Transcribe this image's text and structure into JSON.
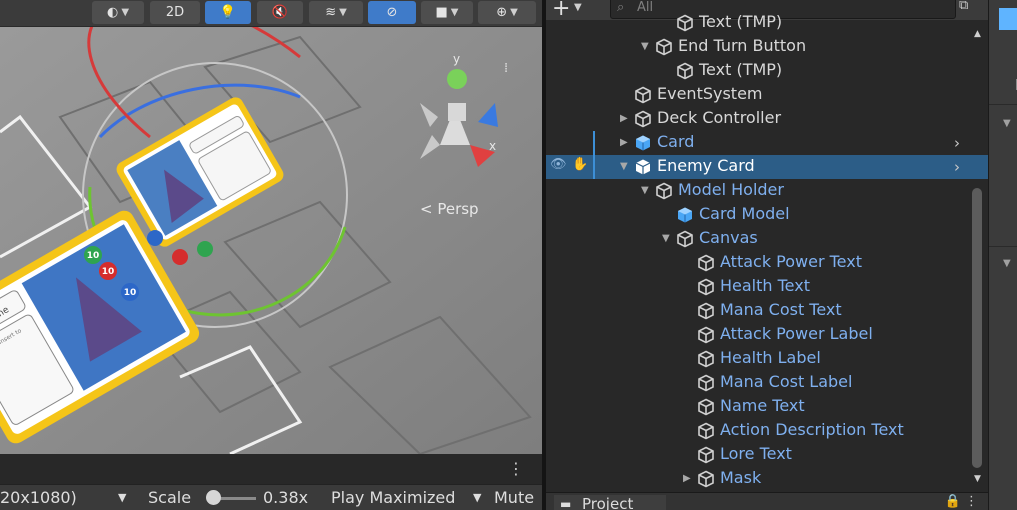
{
  "scene": {
    "toolbar": {
      "mode_2d": "2D",
      "icons": [
        "shading-mode-icon",
        "lighting-bulb-icon",
        "audio-mute-icon",
        "effects-icon",
        "visibility-icon",
        "camera-icon",
        "gizmo-icon"
      ]
    },
    "persp_label": "< Persp",
    "gizmo_axes": {
      "y": "y",
      "x": "x"
    }
  },
  "game": {
    "resolution": "20x1080)",
    "scale_label": "Scale",
    "scale_value": "0.38x",
    "scale_fraction": 0.1,
    "play_mode": "Play Maximized",
    "mute": "Mute"
  },
  "cards": {
    "main": {
      "name": "Card Name",
      "placeholder": "Place to Insert to",
      "lines": [
        "s",
        "ck"
      ]
    },
    "stat_badges": {
      "attack": "10",
      "health": "10",
      "mana": "10"
    }
  },
  "hierarchy": {
    "search_placeholder": "All",
    "items": [
      {
        "label": "Text (TMP)",
        "depth": 2,
        "arrow": "",
        "kind": "gameobject"
      },
      {
        "label": "End Turn Button",
        "depth": 1,
        "arrow": "expanded",
        "kind": "gameobject"
      },
      {
        "label": "Text (TMP)",
        "depth": 2,
        "arrow": "",
        "kind": "gameobject"
      },
      {
        "label": "EventSystem",
        "depth": 0,
        "arrow": "",
        "kind": "gameobject"
      },
      {
        "label": "Deck Controller",
        "depth": 0,
        "arrow": "collapsed",
        "kind": "gameobject"
      },
      {
        "label": "Card",
        "depth": 0,
        "arrow": "collapsed",
        "kind": "prefab",
        "chevron": true
      },
      {
        "label": "Enemy Card",
        "depth": 0,
        "arrow": "expanded",
        "kind": "prefab",
        "chevron": true,
        "selected": true
      },
      {
        "label": "Model Holder",
        "depth": 1,
        "arrow": "expanded",
        "kind": "prefab-child"
      },
      {
        "label": "Card Model",
        "depth": 2,
        "arrow": "",
        "kind": "prefab"
      },
      {
        "label": "Canvas",
        "depth": 2,
        "arrow": "expanded",
        "kind": "prefab-child"
      },
      {
        "label": "Attack Power Text",
        "depth": 3,
        "arrow": "",
        "kind": "prefab-child"
      },
      {
        "label": "Health Text",
        "depth": 3,
        "arrow": "",
        "kind": "prefab-child"
      },
      {
        "label": "Mana Cost Text",
        "depth": 3,
        "arrow": "",
        "kind": "prefab-child"
      },
      {
        "label": "Attack Power Label",
        "depth": 3,
        "arrow": "",
        "kind": "prefab-child"
      },
      {
        "label": "Health Label",
        "depth": 3,
        "arrow": "",
        "kind": "prefab-child"
      },
      {
        "label": "Mana Cost Label",
        "depth": 3,
        "arrow": "",
        "kind": "prefab-child"
      },
      {
        "label": "Name Text",
        "depth": 3,
        "arrow": "",
        "kind": "prefab-child"
      },
      {
        "label": "Action Description Text",
        "depth": 3,
        "arrow": "",
        "kind": "prefab-child"
      },
      {
        "label": "Lore Text",
        "depth": 3,
        "arrow": "",
        "kind": "prefab-child"
      },
      {
        "label": "Mask",
        "depth": 3,
        "arrow": "collapsed",
        "kind": "prefab-child"
      }
    ]
  },
  "project": {
    "tab_label": "Project"
  },
  "inspector": {
    "letter": "P"
  },
  "colors": {
    "prefab_text": "#7fb0ef",
    "selection": "#2c5d87",
    "active_button": "#3f7bc9",
    "card_border": "#f5c518"
  }
}
